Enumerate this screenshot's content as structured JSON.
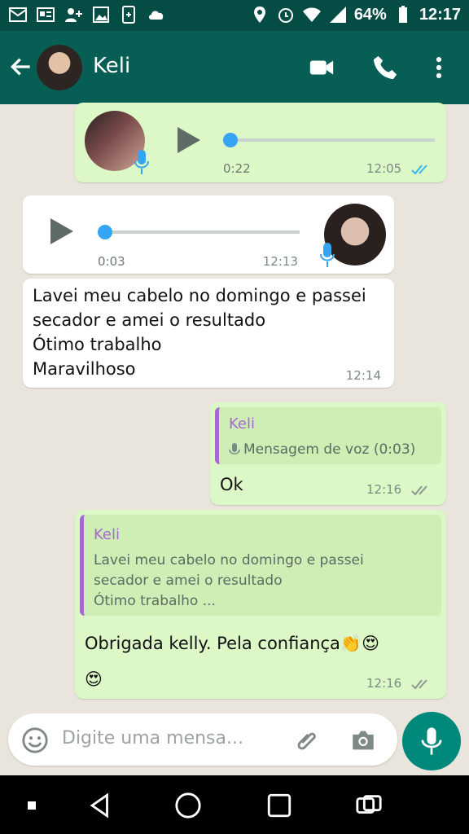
{
  "statusbar": {
    "battery": "64%",
    "time": "12:17"
  },
  "header": {
    "contact_name": "Keli"
  },
  "messages": {
    "voice_out": {
      "duration": "0:22",
      "time": "12:05"
    },
    "voice_in": {
      "duration": "0:03",
      "time": "12:13"
    },
    "text_in": {
      "text": "Lavei meu cabelo no domingo e passei\nsecador e amei o resultado\nÓtimo trabalho\nMaravilhoso",
      "time": "12:14"
    },
    "reply_ok": {
      "quote_name": "Keli",
      "quote_text": "Mensagem de voz (0:03)",
      "text": "Ok",
      "time": "12:16"
    },
    "reply_thanks": {
      "quote_name": "Keli",
      "quote_text": "Lavei meu cabelo no domingo e passei\nsecador e amei o resultado\nÓtimo trabalho ...",
      "text": "Obrigada kelly. Pela confiança👏😍\n😍",
      "time": "12:16"
    }
  },
  "input": {
    "placeholder": "Digite uma mensa..."
  }
}
